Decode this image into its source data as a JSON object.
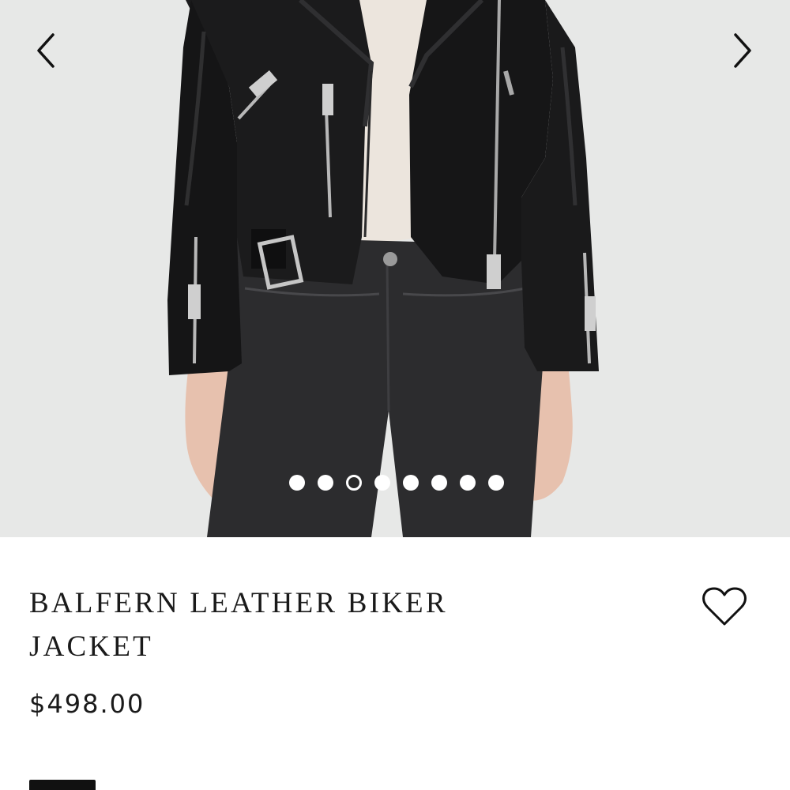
{
  "gallery": {
    "prev_icon": "chevron-left-icon",
    "next_icon": "chevron-right-icon",
    "image_alt": "Model wearing black leather biker jacket with white top and black jeans",
    "slide_count": 8,
    "active_slide": 3
  },
  "product": {
    "title": "BALFERN LEATHER BIKER JACKET",
    "price": "$498.00",
    "wishlist_icon": "heart-outline-icon",
    "selected_color": "#111111"
  },
  "colors": {
    "background": "#e6e7e6",
    "text": "#1a1a1a",
    "dot_active": "#2a2a2a"
  }
}
